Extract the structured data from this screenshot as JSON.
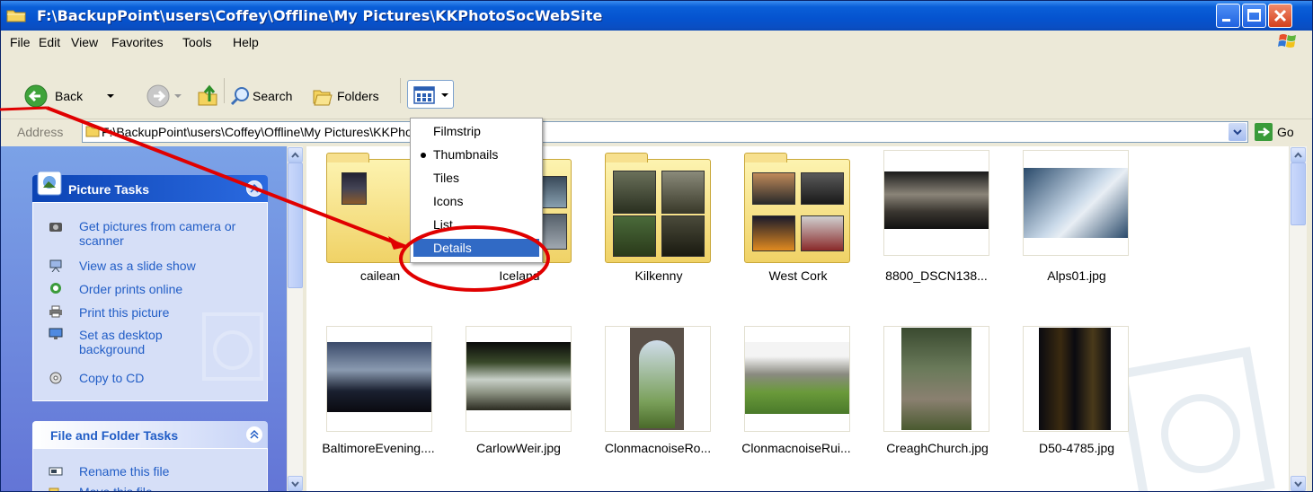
{
  "window": {
    "title": "F:\\BackupPoint\\users\\Coffey\\Offline\\My Pictures\\KKPhotoSocWebSite"
  },
  "menubar": [
    "File",
    "Edit",
    "View",
    "Favorites",
    "Tools",
    "Help"
  ],
  "toolbar": {
    "back": "Back",
    "search": "Search",
    "folders": "Folders"
  },
  "address": {
    "label": "Address",
    "path": "F:\\BackupPoint\\users\\Coffey\\Offline\\My Pictures\\KKPhotoSocWebSite",
    "go": "Go"
  },
  "view_menu": {
    "options": [
      "Filmstrip",
      "Thumbnails",
      "Tiles",
      "Icons",
      "List",
      "Details"
    ],
    "selected": "Thumbnails",
    "highlighted": "Details"
  },
  "picture_tasks": {
    "title": "Picture Tasks",
    "items": [
      "Get pictures from camera or scanner",
      "View as a slide show",
      "Order prints online",
      "Print this picture",
      "Set as desktop background",
      "Copy to CD"
    ]
  },
  "file_tasks": {
    "title": "File and Folder Tasks",
    "items": [
      "Rename this file",
      "Move this file"
    ]
  },
  "files": [
    {
      "name": "cailean",
      "type": "folder"
    },
    {
      "name": "Iceland",
      "type": "folder"
    },
    {
      "name": "Kilkenny",
      "type": "folder"
    },
    {
      "name": "West Cork",
      "type": "folder"
    },
    {
      "name": "8800_DSCN138...",
      "type": "image"
    },
    {
      "name": "Alps01.jpg",
      "type": "image"
    },
    {
      "name": "BaltimoreEvening....",
      "type": "image"
    },
    {
      "name": "CarlowWeir.jpg",
      "type": "image"
    },
    {
      "name": "ClonmacnoiseRo...",
      "type": "image"
    },
    {
      "name": "ClonmacnoiseRui...",
      "type": "image"
    },
    {
      "name": "CreaghChurch.jpg",
      "type": "image"
    },
    {
      "name": "D50-4785.jpg",
      "type": "image"
    }
  ],
  "colors": {
    "title_bar": "#0553cf",
    "task_link": "#215dc6",
    "menu_highlight": "#316ac5",
    "annotation": "#e00000"
  }
}
